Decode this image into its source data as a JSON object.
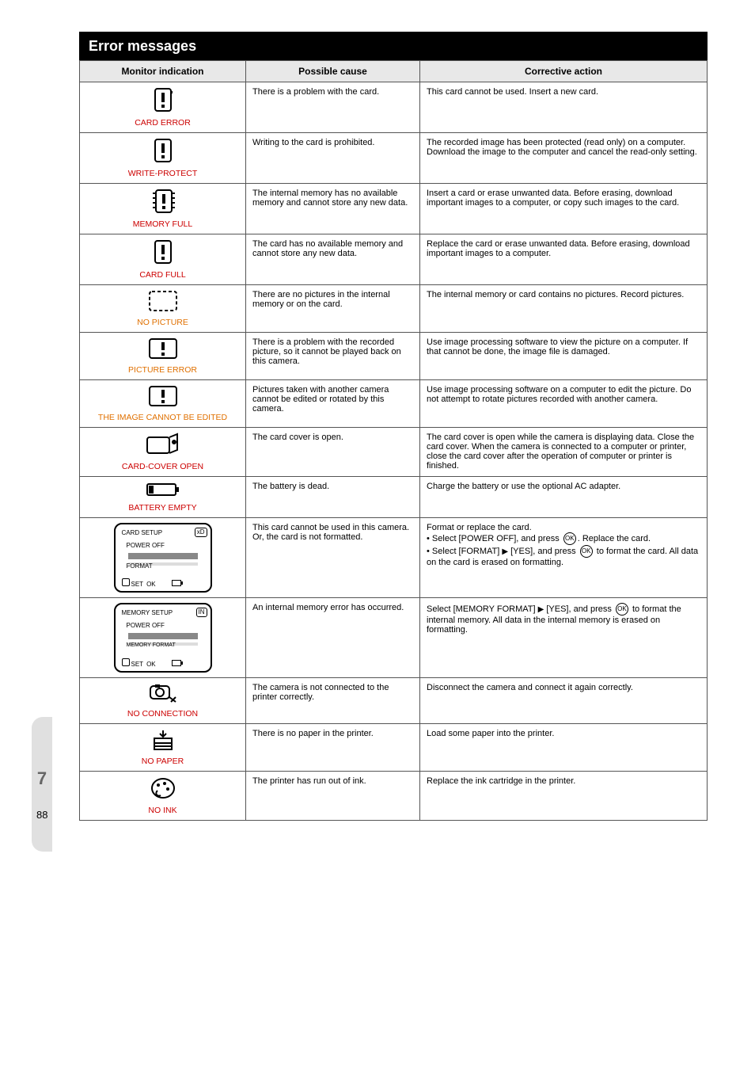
{
  "page": {
    "section_title": "Error messages",
    "side_number": "7",
    "page_number": "88"
  },
  "table": {
    "headers": [
      "Monitor indication",
      "Possible cause",
      "Corrective action"
    ],
    "rows": [
      {
        "icon": "card-warn",
        "label": "CARD ERROR",
        "label_color": "red",
        "cause": "There is a problem with the card.",
        "action": "This card cannot be used. Insert a new card."
      },
      {
        "icon": "card-warn",
        "label": "WRITE-PROTECT",
        "label_color": "red",
        "cause": "Writing to the card is prohibited.",
        "action": "The recorded image has been protected (read only) on a computer. Download the image to the computer and cancel the read-only setting."
      },
      {
        "icon": "card-full",
        "label": "MEMORY FULL",
        "label_color": "red",
        "cause": "The internal memory has no available memory and cannot store any new data.",
        "action": "Insert a card or erase unwanted data. Before erasing, download important images to a computer, or copy such images to the card."
      },
      {
        "icon": "card-warn",
        "label": "CARD FULL",
        "label_color": "red",
        "cause": "The card has no available memory and cannot store any new data.",
        "action": "Replace the card or erase unwanted data. Before erasing, download important images to a computer."
      },
      {
        "icon": "no-picture",
        "label": "NO PICTURE",
        "label_color": "orange",
        "cause": "There are no pictures in the internal memory or on the card.",
        "action": "The internal memory or card contains no pictures. Record pictures."
      },
      {
        "icon": "picture-error",
        "label": "PICTURE ERROR",
        "label_color": "orange",
        "cause": "There is a problem with the recorded picture, so it cannot be played back on this camera.",
        "action": "Use image processing software to view the picture on a computer. If that cannot be done, the image file is damaged."
      },
      {
        "icon": "picture-error",
        "label": "THE IMAGE CANNOT BE EDITED",
        "label_color": "orange",
        "cause": "Pictures taken with another camera cannot be edited or rotated by this camera.",
        "action": "Use image processing software on a computer to edit the picture. Do not attempt to rotate pictures recorded with another camera."
      },
      {
        "icon": "cover-open",
        "label": "CARD-COVER OPEN",
        "label_color": "red",
        "cause": "The card cover is open.",
        "action": "The card cover is open while the camera is displaying data. Close the card cover. When the camera is connected to a computer or printer, close the card cover after the operation of computer or printer is finished."
      },
      {
        "icon": "battery",
        "label": "BATTERY EMPTY",
        "label_color": "red",
        "cause": "The battery is dead.",
        "action": "Charge the battery or use the optional AC adapter."
      },
      {
        "icon": "lcd-xd",
        "label": "CARD SETUP – POWER OFF / FORMAT",
        "label_color": "",
        "cause": "This card cannot be used in this camera. Or, the card is not formatted.",
        "action_prefix": "Format or replace the card.",
        "action_off": "Select [POWER OFF], and press ",
        "action_off_tail": ". Replace the card.",
        "action_fmt": "Select [FORMAT] ",
        "action_fmt_mid": " [YES], and press ",
        "action_fmt_tail": " to format the card. All data on the card is erased on formatting."
      },
      {
        "icon": "lcd-in",
        "label": "MEMORY SETUP – POWER OFF / MEMORY FORMAT",
        "label_color": "",
        "cause": "An internal memory error has occurred.",
        "action_fmt": "Select [MEMORY FORMAT] ",
        "action_fmt_mid": " [YES], and press ",
        "action_fmt_tail": " to format the internal memory. All data in the internal memory is erased on formatting."
      },
      {
        "icon": "no-connect",
        "label": "NO CONNECTION",
        "label_color": "red",
        "cause": "The camera is not connected to the printer correctly.",
        "action": "Disconnect the camera and connect it again correctly."
      },
      {
        "icon": "no-paper",
        "label": "NO PAPER",
        "label_color": "red",
        "cause": "There is no paper in the printer.",
        "action": "Load some paper into the printer."
      },
      {
        "icon": "no-ink",
        "label": "NO INK",
        "label_color": "red",
        "cause": "The printer has run out of ink.",
        "action": "Replace the ink cartridge in the printer."
      }
    ]
  }
}
